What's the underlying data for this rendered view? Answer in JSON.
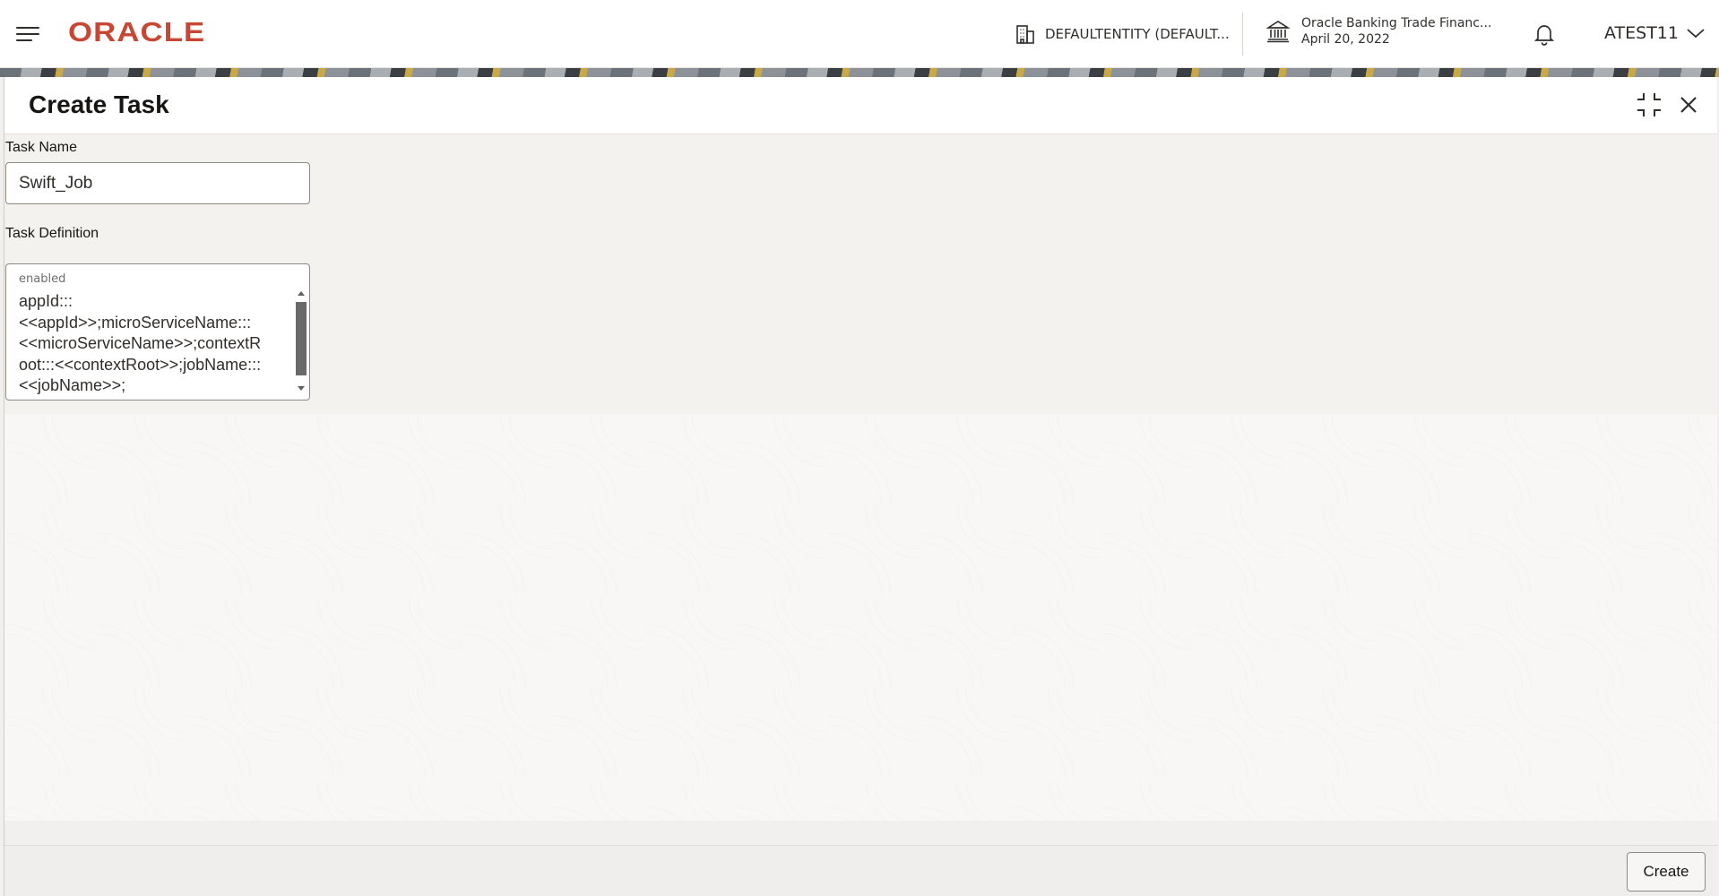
{
  "header": {
    "menu_icon": "hamburger-menu-icon",
    "logo_text": "ORACLE",
    "entity_label": "DEFAULTENTITY (DEFAULT...",
    "entity_icon": "building-icon",
    "branch_name": "Oracle Banking Trade Financ...",
    "branch_date": "April 20, 2022",
    "branch_icon": "bank-icon",
    "notification_icon": "bell-icon",
    "user_name": "ATEST11",
    "user_menu_icon": "chevron-down-icon",
    "brand_color": "#c74634"
  },
  "modal": {
    "title": "Create Task",
    "collapse_icon": "collapse-icon",
    "close_icon": "close-icon"
  },
  "form": {
    "task_name_label": "Task Name",
    "task_name_value": "Swift_Job",
    "task_definition_label": "Task Definition",
    "task_definition_inner_label": "enabled",
    "task_definition_value": "appId:::\n<<appId>>;microServiceName:::\n<<microServiceName>>;contextR\noot:::<<contextRoot>>;jobName:::\n<<jobName>>;"
  },
  "footer": {
    "create_label": "Create"
  }
}
